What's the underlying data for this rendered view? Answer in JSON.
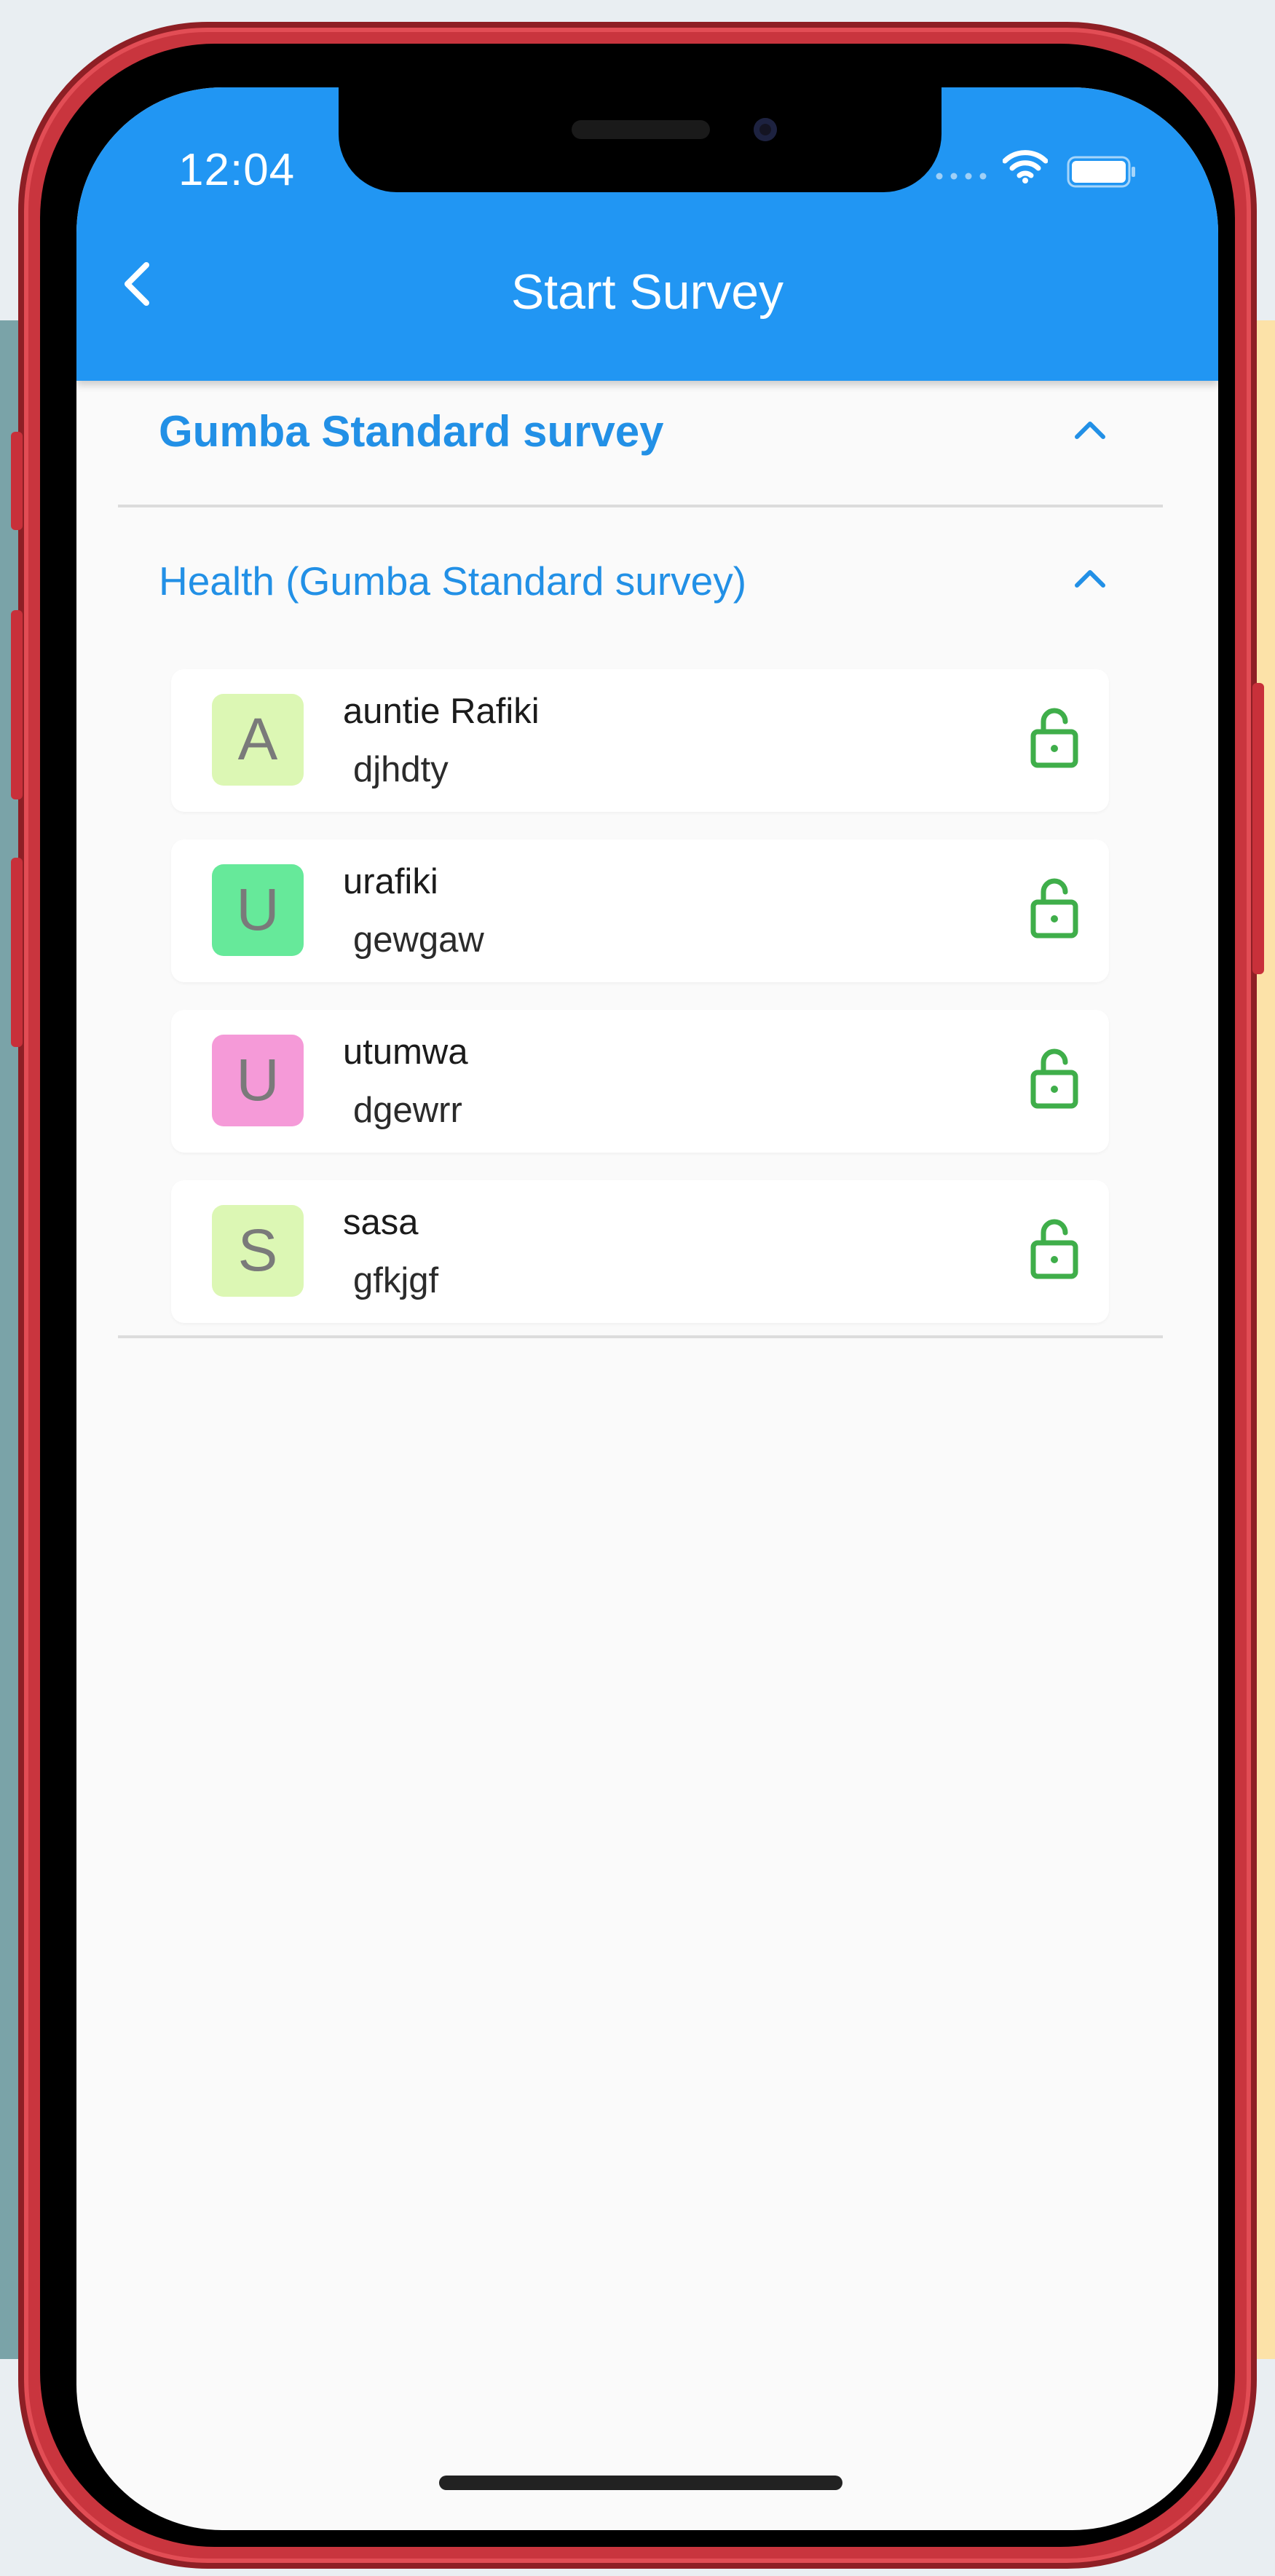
{
  "status_bar": {
    "time": "12:04",
    "signal_icon": "cellular-signal-icon",
    "wifi_icon": "wifi-icon",
    "battery_icon": "battery-full-icon"
  },
  "app_bar": {
    "title": "Start Survey",
    "back_icon": "chevron-left-icon",
    "color": "#2196f3"
  },
  "survey": {
    "title": "Gumba Standard survey",
    "expanded_icon": "chevron-up-icon",
    "section": {
      "title": "Health (Gumba Standard survey)",
      "expanded_icon": "chevron-up-icon",
      "items": [
        {
          "initial": "A",
          "name": "auntie Rafiki",
          "code": "djhdty",
          "avatar_color": "#dcf7b4",
          "status_icon": "lock-open-icon"
        },
        {
          "initial": "U",
          "name": "urafiki",
          "code": "gewgaw",
          "avatar_color": "#66e99a",
          "status_icon": "lock-open-icon"
        },
        {
          "initial": "U",
          "name": "utumwa",
          "code": "dgewrr",
          "avatar_color": "#f59ad8",
          "status_icon": "lock-open-icon"
        },
        {
          "initial": "S",
          "name": "sasa",
          "code": "gfkjgf",
          "avatar_color": "#dcf7b4",
          "status_icon": "lock-open-icon"
        }
      ]
    }
  },
  "colors": {
    "accent": "#2290e6",
    "lock_green": "#3fae4a",
    "background": "#fafafa"
  }
}
